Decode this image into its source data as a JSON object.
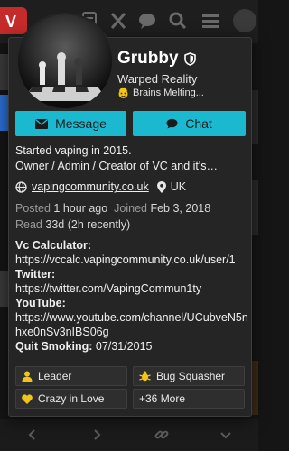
{
  "colors": {
    "accent": "#1bb9cf",
    "badge_gold": "#f2c419",
    "card_bg": "#252525",
    "brand_red": "#c62b2b"
  },
  "topbar": {
    "icons": [
      "logo-icon",
      "document-icon",
      "x-icon",
      "chat-bubble-icon",
      "search-icon",
      "menu-icon",
      "user-avatar-icon"
    ]
  },
  "profile": {
    "username": "Grubby",
    "user_title": "Warped Reality",
    "status": "Brains Melting...",
    "message_button": "Message",
    "chat_button": "Chat",
    "bio_line1": "Started vaping in 2015.",
    "bio_line2": "Owner / Admin / Creator of VC and it's…",
    "website": "vapingcommunity.co.uk",
    "location": "UK",
    "posted_label": "Posted",
    "posted_value": "1 hour ago",
    "joined_label": "Joined",
    "joined_value": "Feb 3, 2018",
    "read_label": "Read",
    "read_value": "33d (2h recently)",
    "fields": [
      {
        "label": "Vc Calculator:",
        "value": "https://vccalc.vapingcommunity.co.uk/user/1"
      },
      {
        "label": "Twitter:",
        "value": "https://twitter.com/VapingCommun1ty"
      },
      {
        "label": "YouTube:",
        "value": "https://www.youtube.com/channel/UCubveN5nhxe0nSv3nIBS06g"
      }
    ],
    "quit_label": "Quit Smoking:",
    "quit_value": "07/31/2015",
    "badges": [
      "Leader",
      "Bug Squasher",
      "Crazy in Love",
      "+36 More"
    ]
  },
  "bottombar": {
    "icons": [
      "chevron-left-icon",
      "chevron-right-icon",
      "link-icon",
      "chevron-down-icon"
    ]
  }
}
